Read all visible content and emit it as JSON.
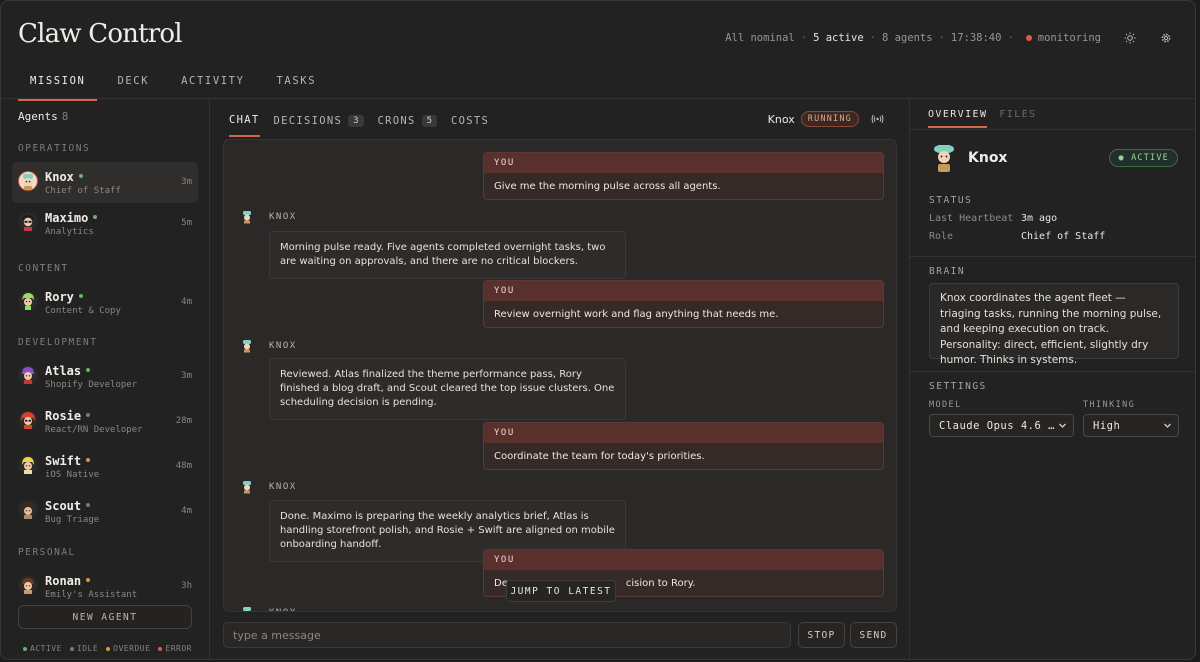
{
  "app": {
    "title": "Claw Control"
  },
  "status": {
    "nominal": "All nominal",
    "active": "5 active",
    "agents": "8 agents",
    "time": "17:38:40",
    "monitor": "monitoring"
  },
  "topnav": [
    "MISSION",
    "DECK",
    "ACTIVITY",
    "TASKS"
  ],
  "sidebar": {
    "title": "Agents",
    "count": "8",
    "sections": [
      "OPERATIONS",
      "CONTENT",
      "DEVELOPMENT",
      "PERSONAL"
    ],
    "agents": [
      {
        "name": "Knox",
        "role": "Chief of Staff",
        "time": "3m",
        "status_color": "#6ab06a"
      },
      {
        "name": "Maximo",
        "role": "Analytics",
        "time": "5m",
        "status_color": "#6ab06a"
      },
      {
        "name": "Rory",
        "role": "Content & Copy",
        "time": "4m",
        "status_color": "#6ab06a"
      },
      {
        "name": "Atlas",
        "role": "Shopify Developer",
        "time": "3m",
        "status_color": "#6ab06a"
      },
      {
        "name": "Rosie",
        "role": "React/RN Developer",
        "time": "28m",
        "status_color": "#7c7874"
      },
      {
        "name": "Swift",
        "role": "iOS Native",
        "time": "48m",
        "status_color": "#d69a3a"
      },
      {
        "name": "Scout",
        "role": "Bug Triage",
        "time": "4m",
        "status_color": "#7c7874"
      },
      {
        "name": "Ronan",
        "role": "Emily's Assistant",
        "time": "3h",
        "status_color": "#d69a3a"
      }
    ],
    "new_agent": "NEW AGENT",
    "legend": [
      {
        "label": "ACTIVE",
        "color": "#6ab06a"
      },
      {
        "label": "IDLE",
        "color": "#7c7874"
      },
      {
        "label": "OVERDUE",
        "color": "#d69a3a"
      },
      {
        "label": "ERROR",
        "color": "#e05a4a"
      }
    ]
  },
  "center": {
    "tabs": [
      {
        "label": "CHAT",
        "badge": ""
      },
      {
        "label": "DECISIONS",
        "badge": "3"
      },
      {
        "label": "CRONS",
        "badge": "5"
      },
      {
        "label": "COSTS",
        "badge": ""
      }
    ],
    "agent_name": "Knox",
    "run_state": "RUNNING",
    "chat": {
      "you_label": "YOU",
      "agent_label": "KNOX",
      "messages": [
        "Give me the morning pulse across all agents.",
        "Morning pulse ready. Five agents completed overnight tasks, two are waiting on approvals, and there are no critical blockers.",
        "Review overnight work and flag anything that needs me.",
        "Reviewed. Atlas finalized the theme performance pass, Rory finished a blog draft, and Scout cleared the top issue clusters. One scheduling decision is pending.",
        "Coordinate the team for today's priorities.",
        "Done. Maximo is preparing the weekly analytics brief, Atlas is handling storefront polish, and Rosie + Swift are aligned on mobile onboarding handoff.",
        "De",
        "cision to Rory."
      ]
    },
    "jump": "JUMP TO LATEST",
    "input_placeholder": "type a message",
    "stop": "STOP",
    "send": "SEND"
  },
  "right": {
    "tabs": [
      "OVERVIEW",
      "FILES"
    ],
    "name": "Knox",
    "badge": "ACTIVE",
    "status_title": "STATUS",
    "heartbeat_label": "Last Heartbeat",
    "heartbeat": "3m ago",
    "role_label": "Role",
    "role": "Chief of Staff",
    "brain_title": "BRAIN",
    "brain": "Knox coordinates the agent fleet — triaging tasks, running the morning pulse, and keeping execution on track. Personality: direct, efficient, slightly dry humor. Thinks in systems.",
    "settings_title": "SETTINGS",
    "model_label": "MODEL",
    "model": "Claude Opus 4.6 …",
    "thinking_label": "THINKING",
    "thinking": "High"
  }
}
